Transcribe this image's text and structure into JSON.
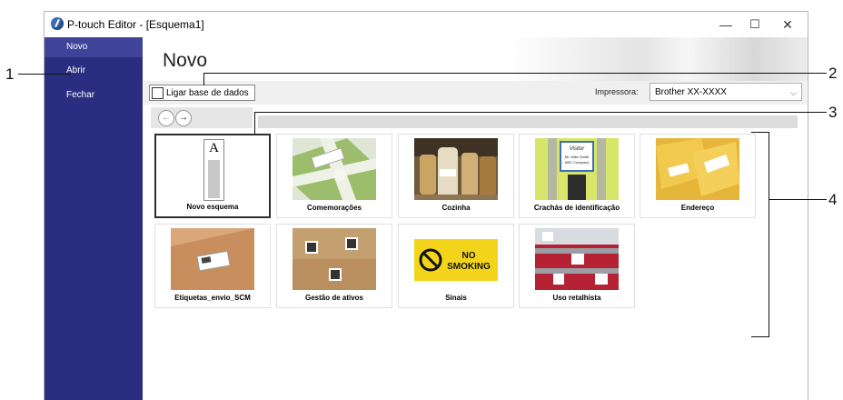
{
  "window": {
    "title": "P-touch Editor - [Esquema1]",
    "minimize": "—",
    "maximize": "☐",
    "close": "✕"
  },
  "sidebar": {
    "items": [
      {
        "label": "Novo"
      },
      {
        "label": "Abrir"
      },
      {
        "label": "Fechar"
      }
    ]
  },
  "main": {
    "title": "Novo",
    "db_checkbox_label": "Ligar base de dados",
    "printer_label": "Impressora:",
    "printer_value": "Brother XX-XXXX",
    "nav": {
      "back": "←",
      "forward": "→"
    }
  },
  "templates": [
    {
      "label": "Novo esquema"
    },
    {
      "label": "Comemorações"
    },
    {
      "label": "Cozinha"
    },
    {
      "label": "Crachás de identificação"
    },
    {
      "label": "Endereço"
    },
    {
      "label": "Etiquetas_envio_SCM"
    },
    {
      "label": "Gestão de ativos"
    },
    {
      "label": "Sinais"
    },
    {
      "label": "Uso retalhista"
    }
  ],
  "blank_doc_letter": "A",
  "badge_text": [
    "Visitor",
    "Mr. Mike Smith",
    "ABC Company"
  ],
  "sign_text": [
    "NO",
    "SMOKING"
  ],
  "callouts": [
    "1",
    "2",
    "3",
    "4"
  ],
  "colors": {
    "sidebar": "#2b2e80",
    "sidebar_selected": "#40439a"
  }
}
